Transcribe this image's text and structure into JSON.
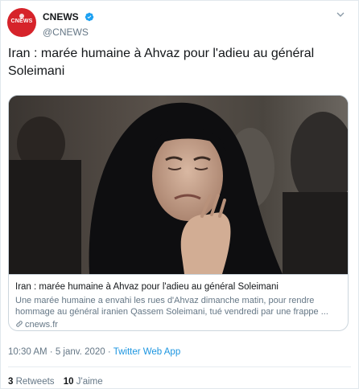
{
  "account": {
    "display_name": "CNEWS",
    "handle": "@CNEWS",
    "avatar_text": "CNEWS"
  },
  "tweet": {
    "text": "Iran : marée humaine à Ahvaz pour l'adieu au général Soleimani"
  },
  "card": {
    "title": "Iran : marée humaine à Ahvaz pour l'adieu au général Soleimani",
    "description": "Une marée humaine a envahi les rues d'Ahvaz dimanche matin, pour rendre hommage au général iranien Qassem Soleimani, tué vendredi par une frappe ...",
    "domain": "cnews.fr"
  },
  "meta": {
    "time": "10:30 AM",
    "separator": "·",
    "date": "5 janv. 2020",
    "separator2": "·",
    "app": "Twitter Web App"
  },
  "stats": {
    "retweets_count": "3",
    "retweets_label": "Retweets",
    "likes_count": "10",
    "likes_label": "J'aime"
  },
  "colors": {
    "brand_red": "#d6232a",
    "verified_blue": "#1da1f2",
    "link_blue": "#1b95e0",
    "muted": "#657786"
  },
  "icons": {
    "verified": "verified-badge-icon",
    "caret": "chevron-down-icon",
    "link": "link-icon"
  }
}
